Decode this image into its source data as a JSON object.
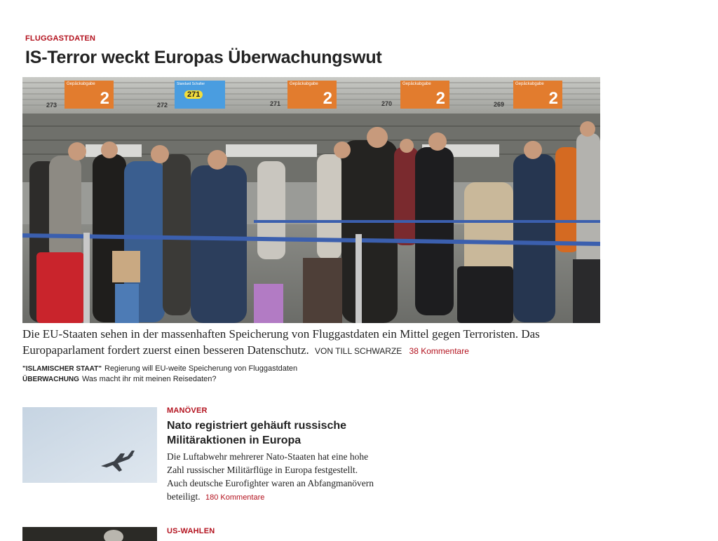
{
  "lead": {
    "kicker": "FLUGGASTDATEN",
    "title": "IS-Terror weckt Europas Überwachungswut",
    "image": {
      "counters": [
        "273",
        "272",
        "271",
        "270",
        "269"
      ],
      "signs": [
        {
          "text": "Gepäckabgabe",
          "number": "2"
        },
        {
          "text": "Standard Schalter",
          "number": "271"
        },
        {
          "text": "Gepäckabgabe",
          "number": "2"
        },
        {
          "text": "Gepäckabgabe",
          "number": "2"
        },
        {
          "text": "Gepäckabgabe",
          "number": "2"
        }
      ]
    },
    "teaser": "Die EU-Staaten sehen in der massenhaften Speicherung von Fluggastdaten ein Mittel gegen Terroristen. Das Europaparlament fordert zuerst einen besseren Datenschutz.",
    "author": "VON TILL SCHWARZE",
    "comments": "38 Kommentare",
    "related": [
      {
        "kicker": "\"Islamischer Staat\"",
        "text": "Regierung will EU-weite Speicherung von Fluggastdaten"
      },
      {
        "kicker": "Überwachung",
        "text": "Was macht ihr mit meinen Reisedaten?"
      }
    ]
  },
  "story2": {
    "kicker": "MANÖVER",
    "title": "Nato registriert gehäuft russische Militäraktionen in Europa",
    "teaser": "Die Luftabwehr mehrerer Nato-Staaten hat eine hohe Zahl russischer Militärflüge in Europa festgestellt. Auch deutsche Eurofighter waren an Abfangmanövern beteiligt.",
    "comments": "180 Kommentare"
  },
  "story3": {
    "kicker": "US-WAHLEN"
  },
  "colors": {
    "accent": "#b3121e",
    "text": "#222222"
  }
}
